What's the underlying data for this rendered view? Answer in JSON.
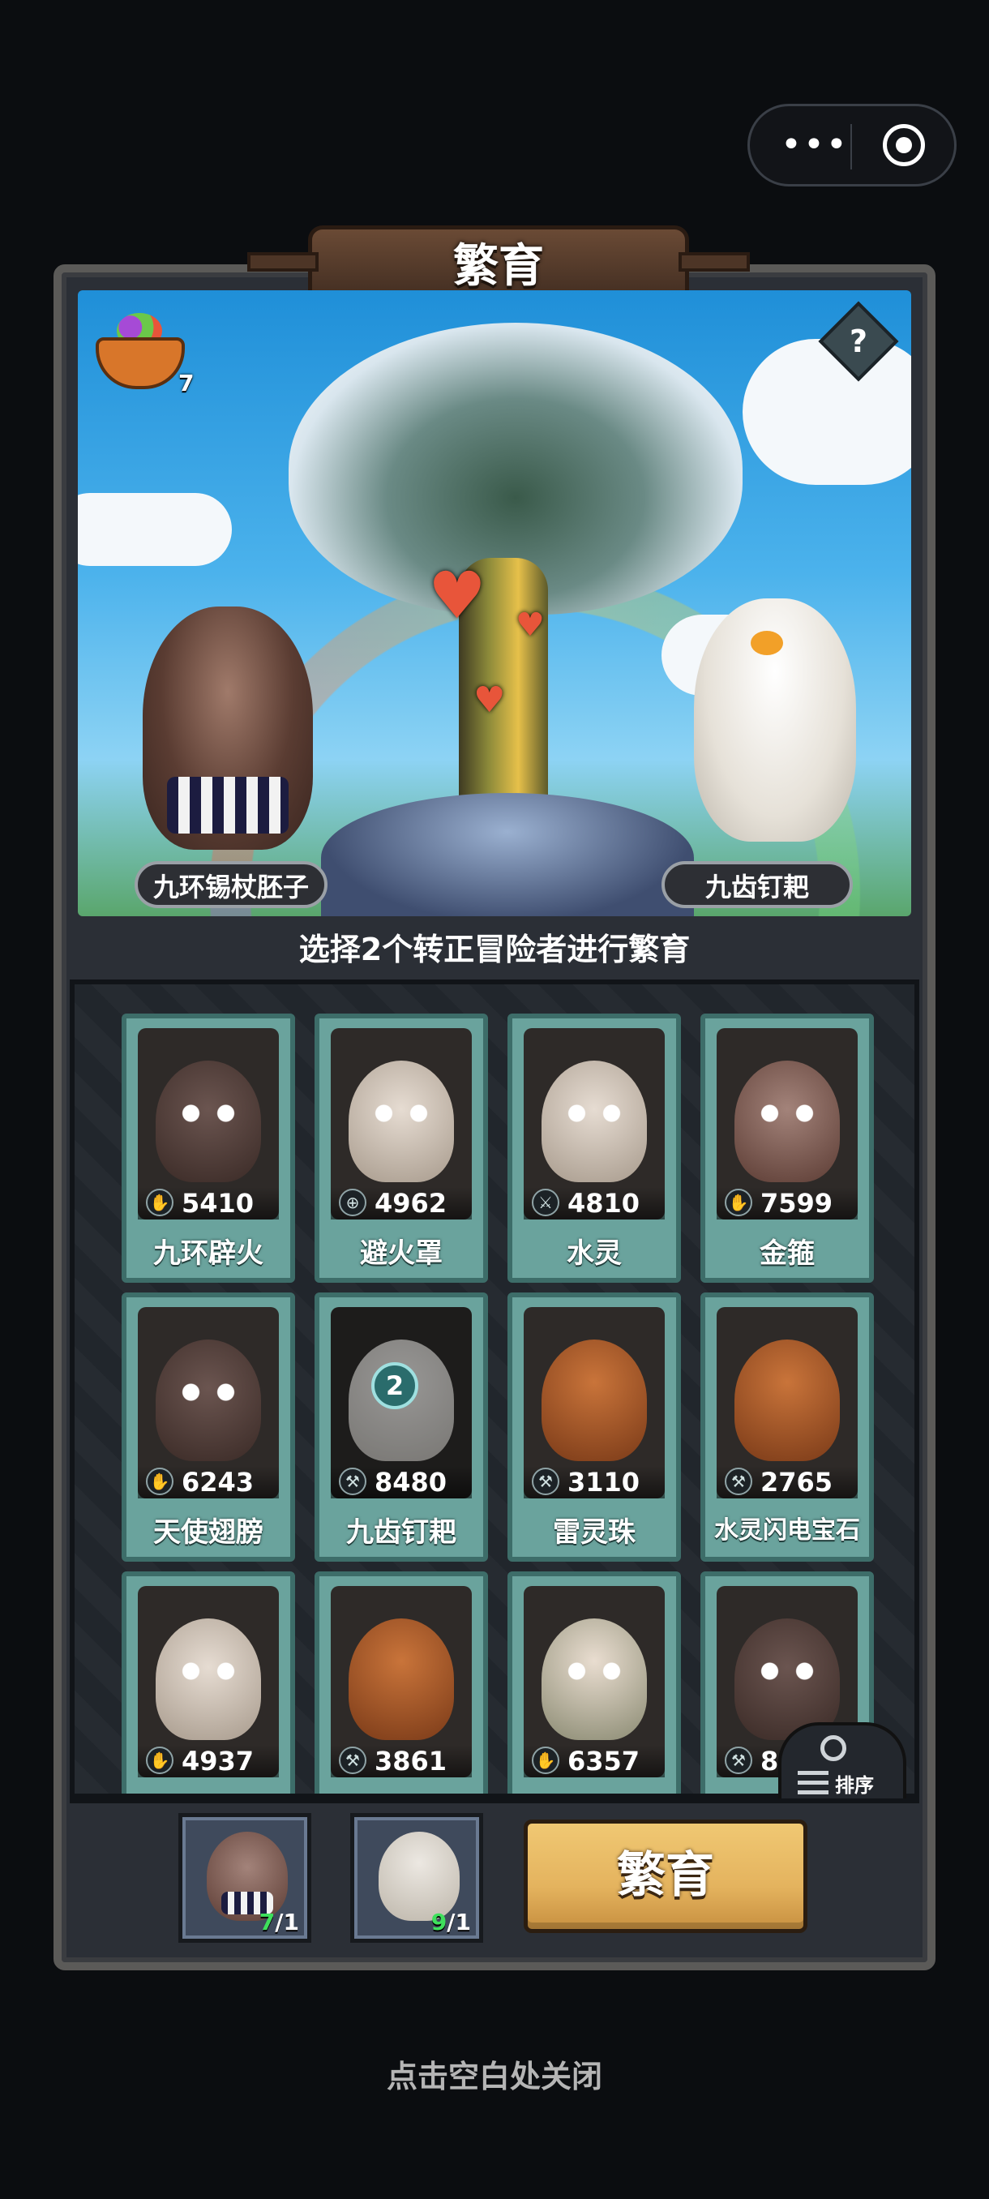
{
  "header": {
    "title": "繁育"
  },
  "scene": {
    "basket_count": "7",
    "help_label": "?",
    "left_name": "九环锡杖胚子",
    "right_name": "九齿钉耙"
  },
  "instruction": "选择2个转正冒险者进行繁育",
  "adventurers": [
    {
      "name": "九环辟火",
      "power": "5410",
      "class_icon": "claw-icon",
      "portrait": "goggles"
    },
    {
      "name": "避火罩",
      "power": "4962",
      "class_icon": "target-icon",
      "portrait": "skull"
    },
    {
      "name": "水灵",
      "power": "4810",
      "class_icon": "sword-icon",
      "portrait": "skull"
    },
    {
      "name": "金箍",
      "power": "7599",
      "class_icon": "claw-icon",
      "portrait": "hippo"
    },
    {
      "name": "天使翅膀",
      "power": "6243",
      "class_icon": "claw-icon",
      "portrait": "goggles"
    },
    {
      "name": "九齿钉耙",
      "power": "8480",
      "class_icon": "wrench-icon",
      "portrait": "chicken",
      "badge": "2"
    },
    {
      "name": "雷灵珠",
      "power": "3110",
      "class_icon": "wrench-icon",
      "portrait": "pumpkin"
    },
    {
      "name": "水灵闪电宝石",
      "power": "2765",
      "class_icon": "wrench-icon",
      "portrait": "pumpkin"
    },
    {
      "name": "",
      "power": "4937",
      "class_icon": "claw-icon",
      "portrait": "skull"
    },
    {
      "name": "",
      "power": "3861",
      "class_icon": "wrench-icon",
      "portrait": "pumpkin"
    },
    {
      "name": "",
      "power": "6357",
      "class_icon": "claw-icon",
      "portrait": "girl"
    },
    {
      "name": "",
      "power": "8",
      "class_icon": "wrench-icon",
      "portrait": "goggles"
    }
  ],
  "sort_label": "排序",
  "slots": [
    {
      "current": "7",
      "total": "/1"
    },
    {
      "current": "9",
      "total": "/1"
    }
  ],
  "breed_button": "繁育",
  "close_hint": "点击空白处关闭"
}
